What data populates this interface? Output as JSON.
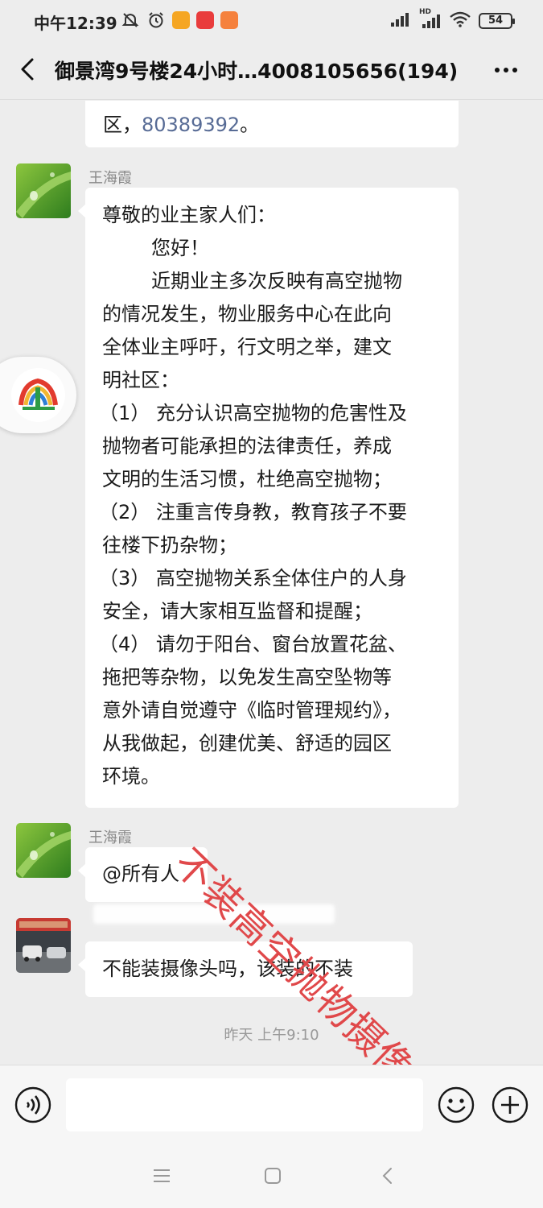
{
  "status_bar": {
    "time": "中午12:39",
    "battery": "54",
    "network_label": "HD",
    "icons": [
      "mute-icon",
      "alarm-icon",
      "app-yellow-icon",
      "app-red-icon",
      "app-orange-icon",
      "signal-icon",
      "hd-signal-icon",
      "wifi-icon",
      "battery-icon"
    ]
  },
  "nav": {
    "title": "御景湾9号楼24小时…4008105656(194)",
    "back_icon": "chevron-left-icon",
    "more_icon": "more-dots-icon"
  },
  "messages": [
    {
      "id": "msg-partial",
      "lines": [
        "区，",
        "。"
      ],
      "link": "80389392"
    },
    {
      "id": "msg-notice",
      "sender": "王海霞",
      "lines": [
        "尊敬的业主家人们：",
        "        您好！",
        "        近期业主多次反映有高空抛物",
        "的情况发生，物业服务中心在此向",
        "全体业主呼吁，行文明之举，建文",
        "明社区：",
        "（1） 充分认识高空抛物的危害性及",
        "抛物者可能承担的法律责任，养成",
        "文明的生活习惯，杜绝高空抛物；",
        "（2） 注重言传身教，教育孩子不要",
        "往楼下扔杂物；",
        "（3） 高空抛物关系全体住户的人身",
        "安全，请大家相互监督和提醒；",
        "（4） 请勿于阳台、窗台放置花盆、",
        "拖把等杂物，以免发生高空坠物等",
        "意外请自觉遵守《临时管理规约》，",
        "从我做起，创建优美、舒适的园区",
        "环境。"
      ]
    },
    {
      "id": "msg-mention",
      "sender": "王海霞",
      "text": "@所有人"
    },
    {
      "id": "msg-reply",
      "sender": "",
      "text": "不能装摄像头吗，该装的不装"
    }
  ],
  "timestamp": "昨天 上午9:10",
  "watermark": "不装高空抛物摄像头",
  "input": {
    "placeholder": "",
    "voice_icon": "voice-icon",
    "emoji_icon": "emoji-icon",
    "plus_icon": "plus-icon"
  },
  "system_nav": [
    "menu-icon",
    "home-icon",
    "back-icon"
  ],
  "colors": {
    "background": "#ededed",
    "bubble": "#ffffff",
    "link": "#576b95",
    "watermark": "#e0484a"
  }
}
